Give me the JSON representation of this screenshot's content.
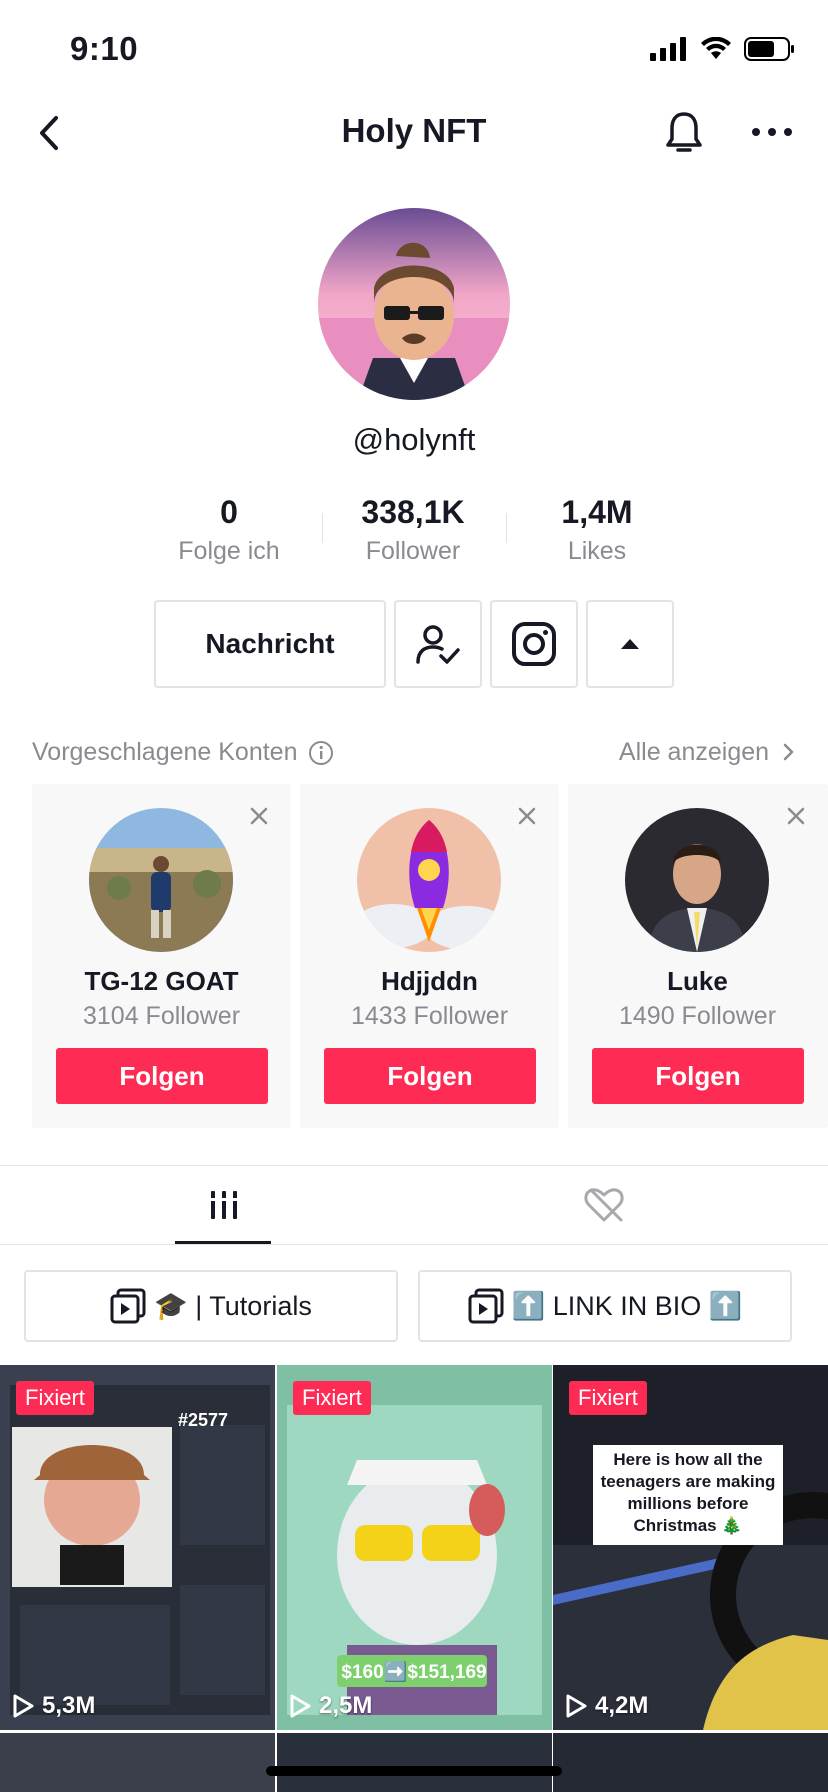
{
  "status_bar": {
    "time": "9:10"
  },
  "nav": {
    "title": "Holy NFT"
  },
  "profile": {
    "handle": "@holynft"
  },
  "stats": [
    {
      "value": "0",
      "label": "Folge ich"
    },
    {
      "value": "338,1K",
      "label": "Follower"
    },
    {
      "value": "1,4M",
      "label": "Likes"
    }
  ],
  "actions": {
    "message_label": "Nachricht"
  },
  "suggested": {
    "title": "Vorgeschlagene Konten",
    "see_all": "Alle anzeigen",
    "cards": [
      {
        "name": "TG-12 GOAT",
        "followers": "3104 Follower",
        "button": "Folgen"
      },
      {
        "name": "Hdjjddn",
        "followers": "1433 Follower",
        "button": "Folgen"
      },
      {
        "name": "Luke",
        "followers": "1490 Follower",
        "button": "Folgen"
      }
    ]
  },
  "playlists": [
    {
      "label": "🎓 | Tutorials"
    },
    {
      "label": "⬆️ LINK IN BIO ⬆️"
    }
  ],
  "videos": [
    {
      "badge": "Fixiert",
      "views": "5,3M",
      "overlay": "#2577"
    },
    {
      "badge": "Fixiert",
      "views": "2,5M",
      "overlay": "$160➡️$151,169"
    },
    {
      "badge": "Fixiert",
      "views": "4,2M",
      "overlay": "Here is how all the teenagers are making millions before Christmas 🎄"
    }
  ],
  "colors": {
    "accent": "#fe2c55",
    "text": "#161823",
    "muted": "#8a8b91"
  }
}
